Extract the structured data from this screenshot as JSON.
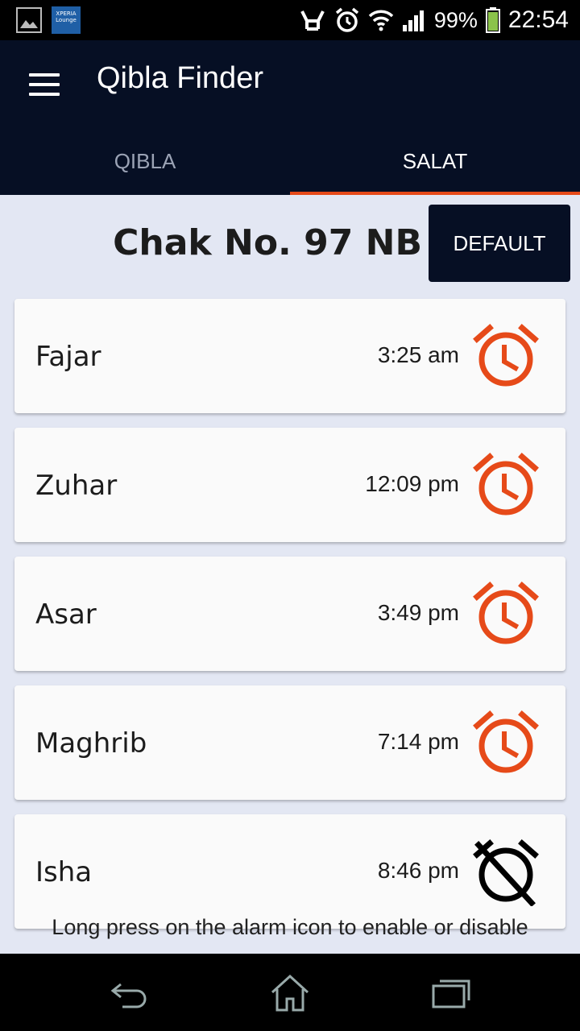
{
  "status_bar": {
    "lounge_label": "XPERIA Lounge",
    "battery": "99%",
    "time": "22:54"
  },
  "app_bar": {
    "title": "Qibla Finder",
    "tabs": [
      {
        "label": "QIBLA",
        "selected": false
      },
      {
        "label": "SALAT",
        "selected": true
      }
    ]
  },
  "location": {
    "name": "Chak No. 97 NB",
    "default_button": "DEFAULT"
  },
  "prayers": [
    {
      "name": "Fajar",
      "time": "3:25 am",
      "alarm": "alarm-on-icon"
    },
    {
      "name": "Zuhar",
      "time": "12:09 pm",
      "alarm": "alarm-on-icon"
    },
    {
      "name": "Asar",
      "time": "3:49 pm",
      "alarm": "alarm-on-icon"
    },
    {
      "name": "Maghrib",
      "time": "7:14 pm",
      "alarm": "alarm-on-icon"
    },
    {
      "name": "Isha",
      "time": "8:46 pm",
      "alarm": "alarm-off-icon"
    }
  ],
  "hint": "Long press on the alarm icon to enable or disable",
  "colors": {
    "appbar": "#060f24",
    "accent": "#e64a19",
    "background": "#e3e7f3"
  }
}
